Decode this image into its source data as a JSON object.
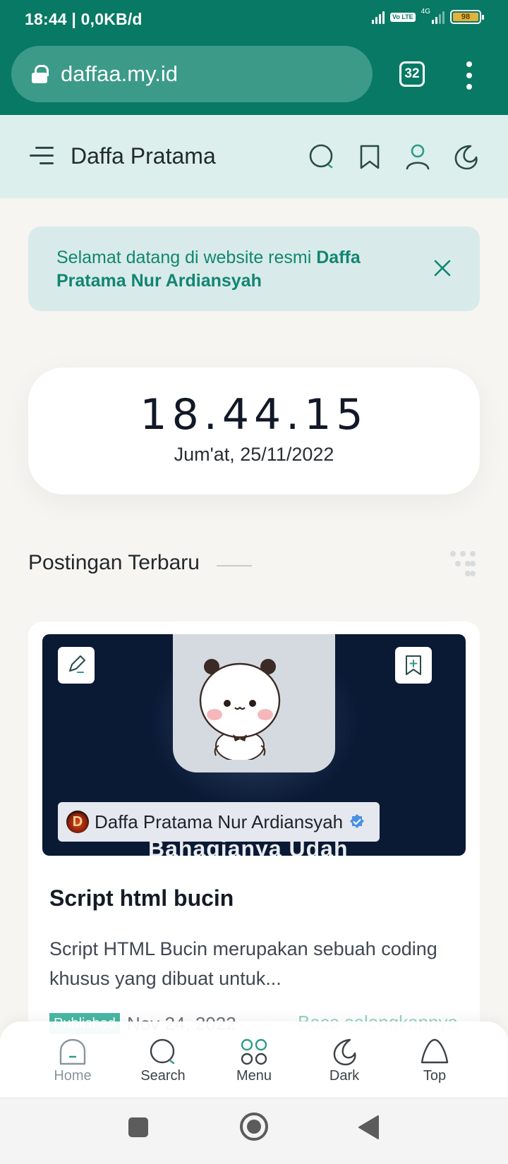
{
  "status_bar": {
    "time_speed": "18:44 | 0,0KB/d",
    "network_label": "4G",
    "volte_label": "Vo LTE",
    "battery": "98"
  },
  "browser": {
    "url": "daffaa.my.id",
    "tab_count": "32"
  },
  "header": {
    "site_title": "Daffa Pratama",
    "icons": [
      "menu-icon",
      "search-icon",
      "bookmark-icon",
      "user-icon",
      "moon-icon"
    ]
  },
  "banner": {
    "text_prefix": "Selamat datang di website resmi ",
    "text_bold": "Daffa Pratama Nur Ardiansyah"
  },
  "clock": {
    "time": "18.44.15",
    "date": "Jum'at, 25/11/2022"
  },
  "section": {
    "title": "Postingan Terbaru"
  },
  "post": {
    "thumbnail_caption": "Bahagianya Udah",
    "author_initial": "D",
    "author": "Daffa Pratama Nur Ardiansyah",
    "title": "Script html bucin",
    "excerpt": "Script HTML Bucin merupakan sebuah coding khusus yang dibuat untuk...",
    "badge": "Published",
    "date": "Nov 24, 2022",
    "read_more": "Baca selengkapnya"
  },
  "bottom_nav": {
    "home": "Home",
    "search": "Search",
    "menu": "Menu",
    "dark": "Dark",
    "top": "Top"
  },
  "colors": {
    "brand": "#087965",
    "accent": "#47b8a3",
    "header_bg": "#dcefed"
  }
}
